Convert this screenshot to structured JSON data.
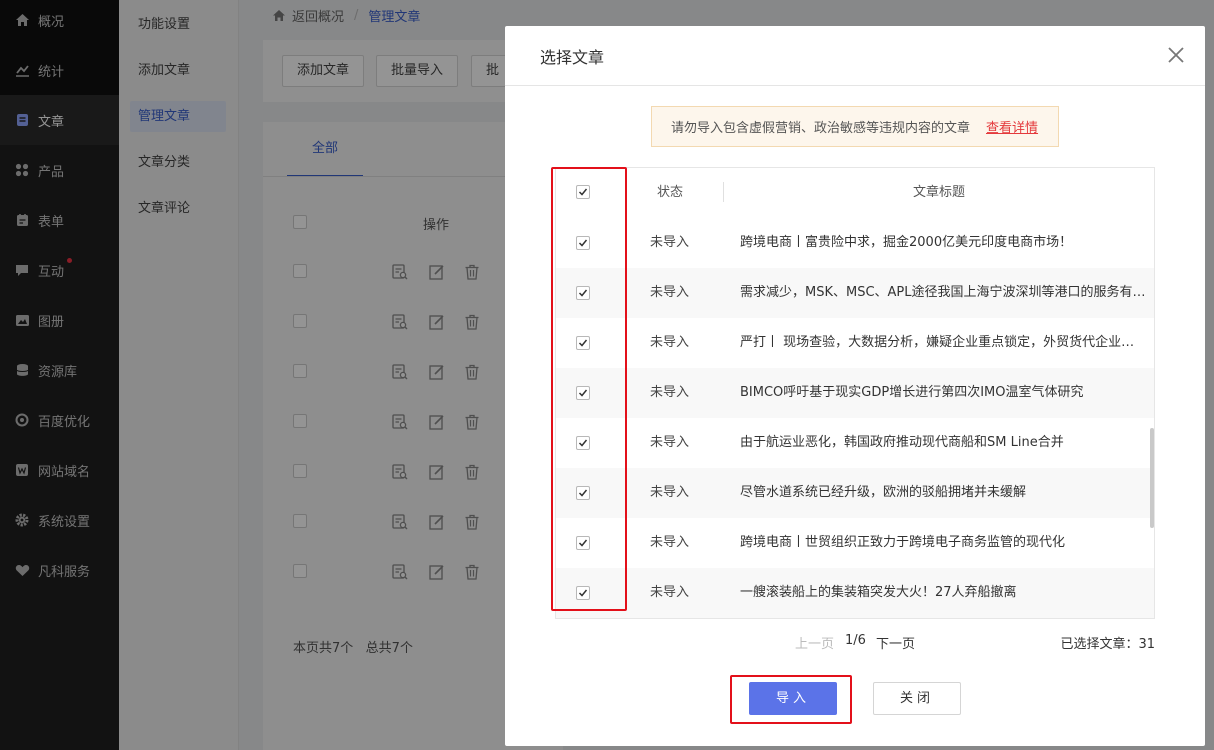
{
  "nav": {
    "items": [
      {
        "label": "概况",
        "icon": "home-icon"
      },
      {
        "label": "统计",
        "icon": "chart-icon"
      },
      {
        "label": "文章",
        "icon": "document-icon",
        "active": true
      },
      {
        "label": "产品",
        "icon": "grid-icon"
      },
      {
        "label": "表单",
        "icon": "form-icon"
      },
      {
        "label": "互动",
        "icon": "chat-icon",
        "badge": true
      },
      {
        "label": "图册",
        "icon": "image-icon"
      },
      {
        "label": "资源库",
        "icon": "database-icon"
      },
      {
        "label": "百度优化",
        "icon": "seo-icon"
      },
      {
        "label": "网站域名",
        "icon": "domain-icon"
      },
      {
        "label": "系统设置",
        "icon": "gear-icon"
      },
      {
        "label": "凡科服务",
        "icon": "heart-icon"
      }
    ]
  },
  "subnav": {
    "items": [
      {
        "label": "功能设置"
      },
      {
        "label": "添加文章"
      },
      {
        "label": "管理文章",
        "active": true
      },
      {
        "label": "文章分类"
      },
      {
        "label": "文章评论"
      }
    ]
  },
  "breadcrumb": {
    "back": "返回概况",
    "sep": "/",
    "current": "管理文章"
  },
  "toolbar": {
    "add": "添加文章",
    "batch_import": "批量导入",
    "batch_more": "批量"
  },
  "list": {
    "tab_all": "全部",
    "op_header": "操作",
    "footer": "本页共7个   总共7个"
  },
  "modal": {
    "title": "选择文章",
    "notice": "请勿导入包含虚假营销、政治敏感等违规内容的文章",
    "notice_link": "查看详情",
    "col_status": "状态",
    "col_title": "文章标题",
    "rows": [
      {
        "status": "未导入",
        "title": "跨境电商丨富贵险中求，掘金2000亿美元印度电商市场！"
      },
      {
        "status": "未导入",
        "title": "需求减少，MSK、MSC、APL途径我国上海宁波深圳等港口的服务有所调整"
      },
      {
        "status": "未导入",
        "title": "严打丨 现场查验，大数据分析，嫌疑企业重点锁定，外贸货代企业需警惕"
      },
      {
        "status": "未导入",
        "title": "BIMCO呼吁基于现实GDP增长进行第四次IMO温室气体研究"
      },
      {
        "status": "未导入",
        "title": "由于航运业恶化，韩国政府推动现代商船和SM Line合并"
      },
      {
        "status": "未导入",
        "title": "尽管水道系统已经升级，欧洲的驳船拥堵并未缓解"
      },
      {
        "status": "未导入",
        "title": "跨境电商丨世贸组织正致力于跨境电子商务监管的现代化"
      },
      {
        "status": "未导入",
        "title": "一艘滚装船上的集装箱突发大火！27人弃船撤离"
      }
    ],
    "pager": {
      "prev": "上一页",
      "page": "1/6",
      "next": "下一页"
    },
    "selected": "已选择文章：31",
    "import_button": "导入",
    "close_button": "关闭"
  }
}
